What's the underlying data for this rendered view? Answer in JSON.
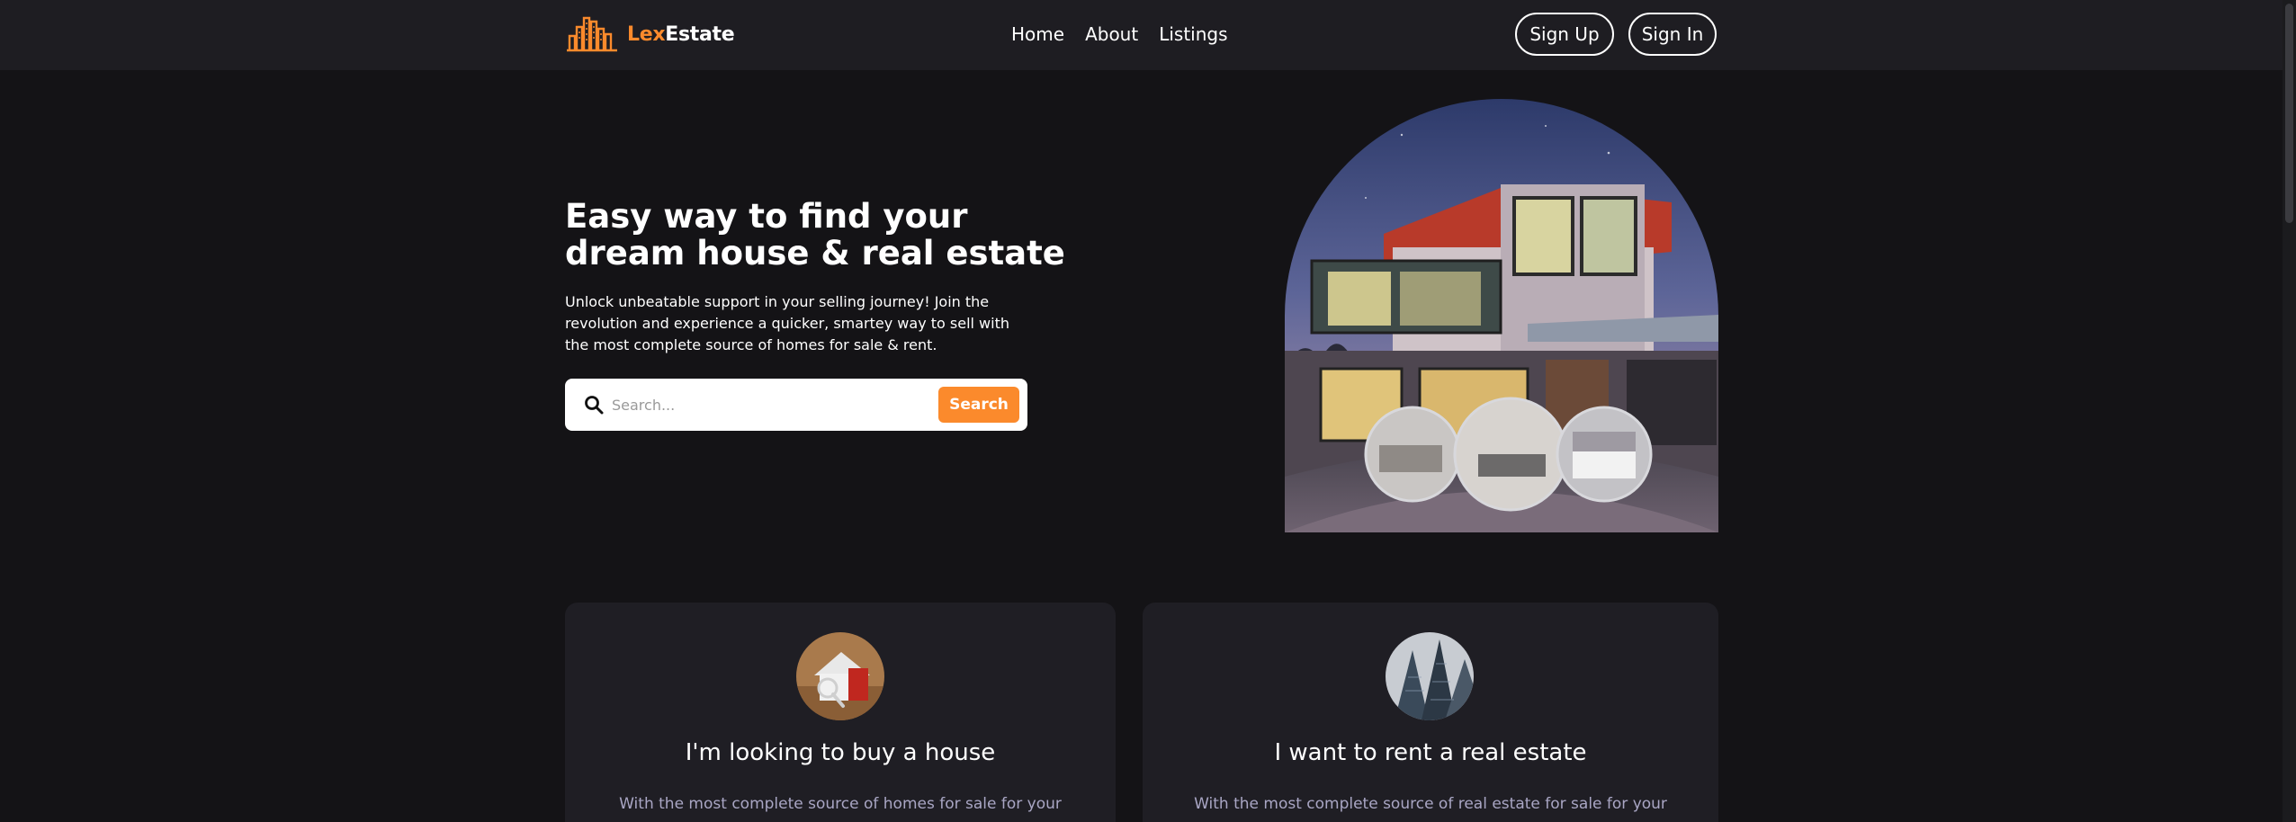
{
  "brand": {
    "name_part1": "Lex",
    "name_part2": "Estate",
    "logo_icon": "buildings-icon",
    "accent_color": "#fb8a2c"
  },
  "nav": {
    "links": [
      "Home",
      "About",
      "Listings"
    ],
    "signup_label": "Sign Up",
    "signin_label": "Sign In"
  },
  "hero": {
    "title": "Easy way to find your dream house & real estate",
    "description": "Unlock unbeatable support in your selling journey! Join the revolution and experience a quicker, smartey way to sell with the most complete source of homes for sale & rent.",
    "search": {
      "placeholder": "Search...",
      "button_label": "Search",
      "icon": "search-icon"
    },
    "image": "modern-house-photo"
  },
  "cards": [
    {
      "title": "I'm looking to buy a house",
      "text": "With the most complete source of homes for sale for your",
      "image": "house-model-photo"
    },
    {
      "title": "I want to rent a real estate",
      "text": "With the most complete source of real estate for sale for your",
      "image": "skyscrapers-photo"
    }
  ],
  "colors": {
    "background": "#141316",
    "navbar": "#1e1d22",
    "card": "#1f1e24",
    "muted_text": "#a9a6c4"
  }
}
